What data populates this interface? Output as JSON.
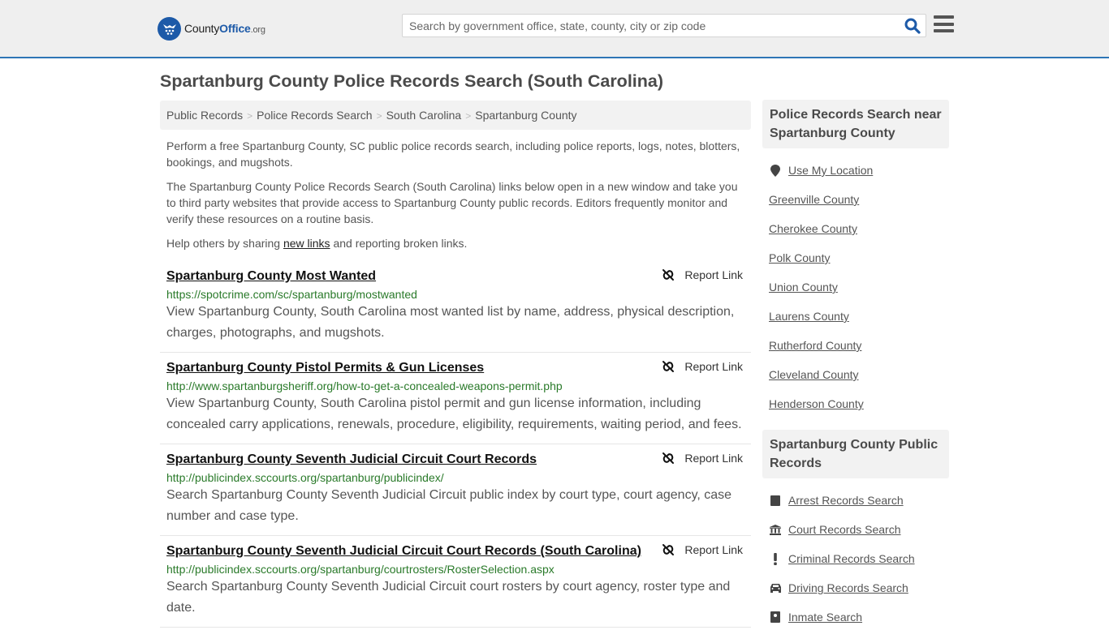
{
  "header": {
    "logo": {
      "name": "County",
      "name_bold": "Office",
      "tld": ".org"
    },
    "search": {
      "placeholder": "Search by government office, state, county, city or zip code",
      "value": ""
    },
    "colors": {
      "brand": "#1d5aa8",
      "accent_border": "#2e75b6"
    }
  },
  "page": {
    "title": "Spartanburg County Police Records Search (South Carolina)"
  },
  "breadcrumb": [
    "Public Records",
    "Police Records Search",
    "South Carolina",
    "Spartanburg County"
  ],
  "intro": {
    "p1": "Perform a free Spartanburg County, SC public police records search, including police reports, logs, notes, blotters, bookings, and mugshots.",
    "p2": "The Spartanburg County Police Records Search (South Carolina) links below open in a new window and take you to third party websites that provide access to Spartanburg County public records. Editors frequently monitor and verify these resources on a routine basis.",
    "p3_before": "Help others by sharing ",
    "p3_link": "new links",
    "p3_after": " and reporting broken links."
  },
  "report_label": "Report Link",
  "results": [
    {
      "title": "Spartanburg County Most Wanted",
      "url": "https://spotcrime.com/sc/spartanburg/mostwanted",
      "desc": "View Spartanburg County, South Carolina most wanted list by name, address, physical description, charges, photographs, and mugshots."
    },
    {
      "title": "Spartanburg County Pistol Permits & Gun Licenses",
      "url": "http://www.spartanburgsheriff.org/how-to-get-a-concealed-weapons-permit.php",
      "desc": "View Spartanburg County, South Carolina pistol permit and gun license information, including concealed carry applications, renewals, procedure, eligibility, requirements, waiting period, and fees."
    },
    {
      "title": "Spartanburg County Seventh Judicial Circuit Court Records",
      "url": "http://publicindex.sccourts.org/spartanburg/publicindex/",
      "desc": "Search Spartanburg County Seventh Judicial Circuit public index by court type, court agency, case number and case type."
    },
    {
      "title": "Spartanburg County Seventh Judicial Circuit Court Records (South Carolina)",
      "url": "http://publicindex.sccourts.org/spartanburg/courtrosters/RosterSelection.aspx",
      "desc": "Search Spartanburg County Seventh Judicial Circuit court rosters by court agency, roster type and date."
    }
  ],
  "sidebar": {
    "nearby": {
      "title": "Police Records Search near Spartanburg County",
      "use_location": "Use My Location",
      "items": [
        "Greenville County",
        "Cherokee County",
        "Polk County",
        "Union County",
        "Laurens County",
        "Rutherford County",
        "Cleveland County",
        "Henderson County"
      ]
    },
    "public_records": {
      "title": "Spartanburg County Public Records",
      "items": [
        {
          "label": "Arrest Records Search",
          "icon": "book-icon"
        },
        {
          "label": "Court Records Search",
          "icon": "courthouse-icon"
        },
        {
          "label": "Criminal Records Search",
          "icon": "exclamation-icon"
        },
        {
          "label": "Driving Records Search",
          "icon": "car-icon"
        },
        {
          "label": "Inmate Search",
          "icon": "id-card-icon"
        }
      ]
    }
  }
}
